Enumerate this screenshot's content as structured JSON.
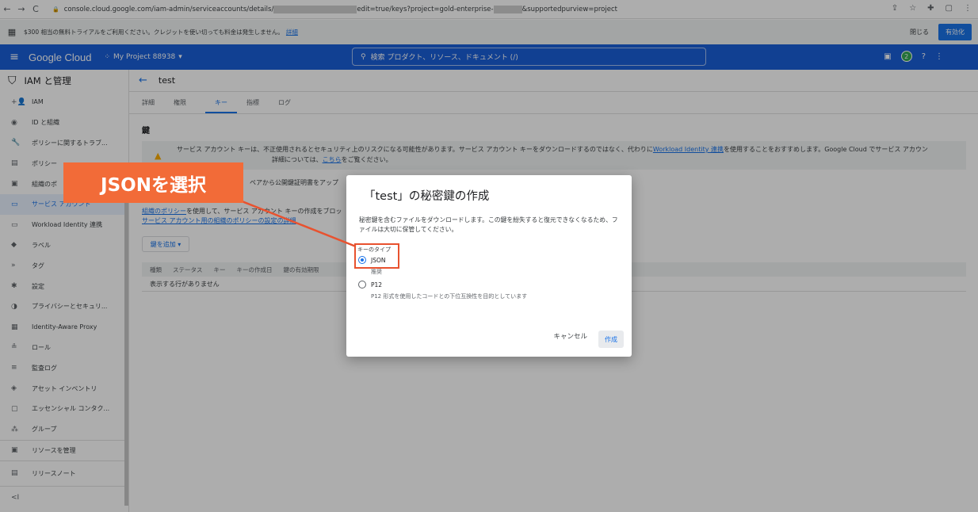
{
  "browser": {
    "url_prefix": "console.cloud.google.com/iam-admin/serviceaccounts/details/",
    "url_mid": "edit=true/keys?project=gold-enterprise-",
    "url_suffix": "&supportedpurview=project",
    "back": "←",
    "forward": "→",
    "reload": "C"
  },
  "trial": {
    "text": "$300 相当の無料トライアルをご利用ください。クレジットを使い切っても料金は発生しません。",
    "link": "詳細",
    "close": "閉じる",
    "activate": "有効化"
  },
  "header": {
    "logo": "Google Cloud",
    "project": "My Project 88938",
    "search_placeholder": "検索 プロダクト、リソース、ドキュメント (/)",
    "badge_count": "2"
  },
  "sidebar": {
    "title": "IAM と管理",
    "items": [
      {
        "label": "IAM",
        "icon": "+👤"
      },
      {
        "label": "ID と組織",
        "icon": "◉"
      },
      {
        "label": "ポリシーに関するトラブ...",
        "icon": "🔧"
      },
      {
        "label": "ポリシー",
        "icon": "▤"
      },
      {
        "label": "組織のポ",
        "icon": "▣"
      },
      {
        "label": "サービス アカウント",
        "icon": "▭"
      },
      {
        "label": "Workload Identity 連携",
        "icon": "▭"
      },
      {
        "label": "ラベル",
        "icon": "◆"
      },
      {
        "label": "タグ",
        "icon": "»"
      },
      {
        "label": "設定",
        "icon": "✱"
      },
      {
        "label": "プライバシーとセキュリ...",
        "icon": "◑"
      },
      {
        "label": "Identity-Aware Proxy",
        "icon": "▦"
      },
      {
        "label": "ロール",
        "icon": "≗"
      },
      {
        "label": "監査ログ",
        "icon": "≡"
      },
      {
        "label": "アセット インベントリ",
        "icon": "◈"
      },
      {
        "label": "エッセンシャル コンタク...",
        "icon": "▢"
      },
      {
        "label": "グループ",
        "icon": "⁂"
      }
    ],
    "bottom": [
      {
        "label": "リソースを管理",
        "icon": "▣"
      },
      {
        "label": "リリースノート",
        "icon": "▤"
      }
    ],
    "collapse": "<I"
  },
  "main": {
    "page_title": "test",
    "tabs": [
      "詳細",
      "権限",
      "キー",
      "指標",
      "ログ"
    ],
    "section_title": "鍵",
    "warning_line1_a": "サービス アカウント キーは、不正使用されるとセキュリティ上のリスクになる可能性があります。サービス アカウント キーをダウンロードするのではなく、代わりに",
    "warning_link1": "Workload Identity 連携",
    "warning_line1_b": "を使用することをおすすめします。Google Cloud でサービス アカウン",
    "warning_line2_a": "詳細については、",
    "warning_link2": "こちら",
    "warning_line2_b": "をご覧ください。",
    "line_upload": "ペアから公開鍵証明書をアップ",
    "policy_link": "組織のポリシー",
    "policy_text": "を使用して、サービス アカウント キーの作成をブロッ",
    "policy_link2": "サービス アカウント用の組織のポリシーの設定の詳細",
    "add_key": "鍵を追加 ▾",
    "table_headers": [
      "種類",
      "ステータス",
      "キー",
      "キーの作成日",
      "鍵の有効期限"
    ],
    "table_empty": "表示する行がありません"
  },
  "dialog": {
    "title": "「test」の秘密鍵の作成",
    "description": "秘密鍵を含むファイルをダウンロードします。この鍵を紛失すると復元できなくなるため、ファイルは大切に保管してください。",
    "key_type_label": "キーのタイプ",
    "options": [
      {
        "label": "JSON",
        "sub": "推奨",
        "checked": true
      },
      {
        "label": "P12",
        "sub": "P12 形式を使用したコードとの下位互換性を目的としています",
        "checked": false
      }
    ],
    "cancel": "キャンセル",
    "create": "作成"
  },
  "annotation": {
    "callout": "JSONを選択",
    "color": "#f26b38"
  }
}
